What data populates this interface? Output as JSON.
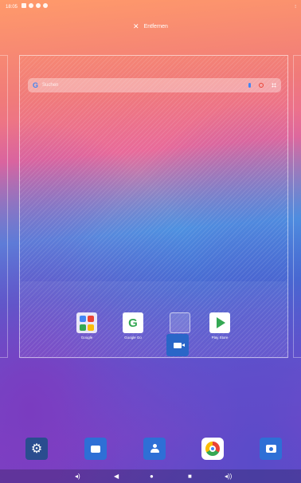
{
  "status_bar": {
    "time": "18:05",
    "right": "⁝"
  },
  "remove_bar": {
    "icon": "close-icon",
    "label": "Entfernen"
  },
  "search": {
    "placeholder": "Suchen",
    "logo": "G"
  },
  "apps": [
    {
      "name": "Google",
      "icon": "google-folder-icon"
    },
    {
      "name": "Google Go",
      "icon": "google-go-icon"
    },
    {
      "name": "",
      "icon": "empty-slot"
    },
    {
      "name": "Play Store",
      "icon": "play-store-icon"
    }
  ],
  "dock": [
    {
      "name": "settings",
      "icon": "gear-icon"
    },
    {
      "name": "messages",
      "icon": "messages-icon"
    },
    {
      "name": "contacts",
      "icon": "contacts-icon"
    },
    {
      "name": "chrome",
      "icon": "chrome-icon"
    },
    {
      "name": "camera",
      "icon": "camera-icon"
    }
  ],
  "nav": {
    "vol_down": "◂)",
    "back": "◀",
    "home": "●",
    "recents": "■",
    "vol_up": "◂))"
  },
  "colors": {
    "accent": "#2e6fd6",
    "settings_bg": "#2a4d8f"
  }
}
